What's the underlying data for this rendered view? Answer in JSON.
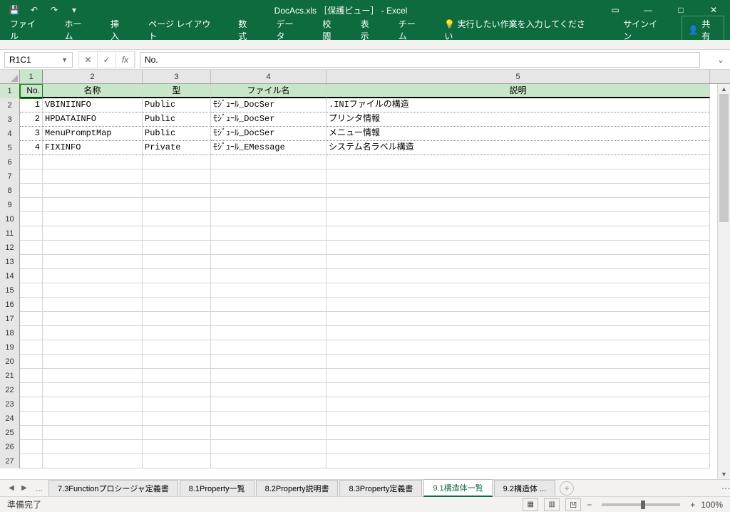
{
  "title": "DocAcs.xls ［保護ビュー］ - Excel",
  "qat": {
    "save": "💾",
    "undo": "↶",
    "redo": "↷",
    "custom": "▾"
  },
  "winctrl": {
    "ribbon_opts": "▭",
    "min": "—",
    "max": "□",
    "close": "✕"
  },
  "ribbon": {
    "file": "ファイル",
    "home": "ホーム",
    "insert": "挿入",
    "layout": "ページ レイアウト",
    "formulas": "数式",
    "data": "データ",
    "review": "校閲",
    "view": "表示",
    "team": "チーム",
    "tell": "実行したい作業を入力してください",
    "signin": "サインイン",
    "share": "共有"
  },
  "namebox": "R1C1",
  "formula": "No.",
  "fb": {
    "cancel": "✕",
    "enter": "✓",
    "fx": "fx"
  },
  "colGroups": [
    "1",
    "2",
    "3",
    "4",
    "5"
  ],
  "headers": {
    "no": "No.",
    "name": "名称",
    "type": "型",
    "file": "ファイル名",
    "desc": "説明"
  },
  "rows": [
    {
      "n": "1",
      "name": "VBINIINFO",
      "type": "Public",
      "file": "ﾓｼﾞｭｰﾙ_DocSer",
      "desc": ".INIファイルの構造"
    },
    {
      "n": "2",
      "name": "HPDATAINFO",
      "type": "Public",
      "file": "ﾓｼﾞｭｰﾙ_DocSer",
      "desc": "プリンタ情報"
    },
    {
      "n": "3",
      "name": "MenuPromptMap",
      "type": "Public",
      "file": "ﾓｼﾞｭｰﾙ_DocSer",
      "desc": "メニュー情報"
    },
    {
      "n": "4",
      "name": "FIXINFO",
      "type": "Private",
      "file": "ﾓｼﾞｭｰﾙ_EMessage",
      "desc": "システム名ラベル構造"
    }
  ],
  "rowLabels": [
    "1",
    "2",
    "3",
    "4",
    "5",
    "6",
    "7",
    "8",
    "9",
    "10",
    "11",
    "12",
    "13",
    "14",
    "15",
    "16",
    "17",
    "18",
    "19",
    "20",
    "21",
    "22",
    "23",
    "24",
    "25",
    "26",
    "27"
  ],
  "tabs": {
    "t1": "7.3Functionプロシージャ定義書",
    "t2": "8.1Property一覧",
    "t3": "8.2Property説明書",
    "t4": "8.3Property定義書",
    "t5": "9.1構造体一覧",
    "t6": "9.2構造体 ..."
  },
  "status": {
    "ready": "準備完了",
    "zoom": "100%"
  }
}
